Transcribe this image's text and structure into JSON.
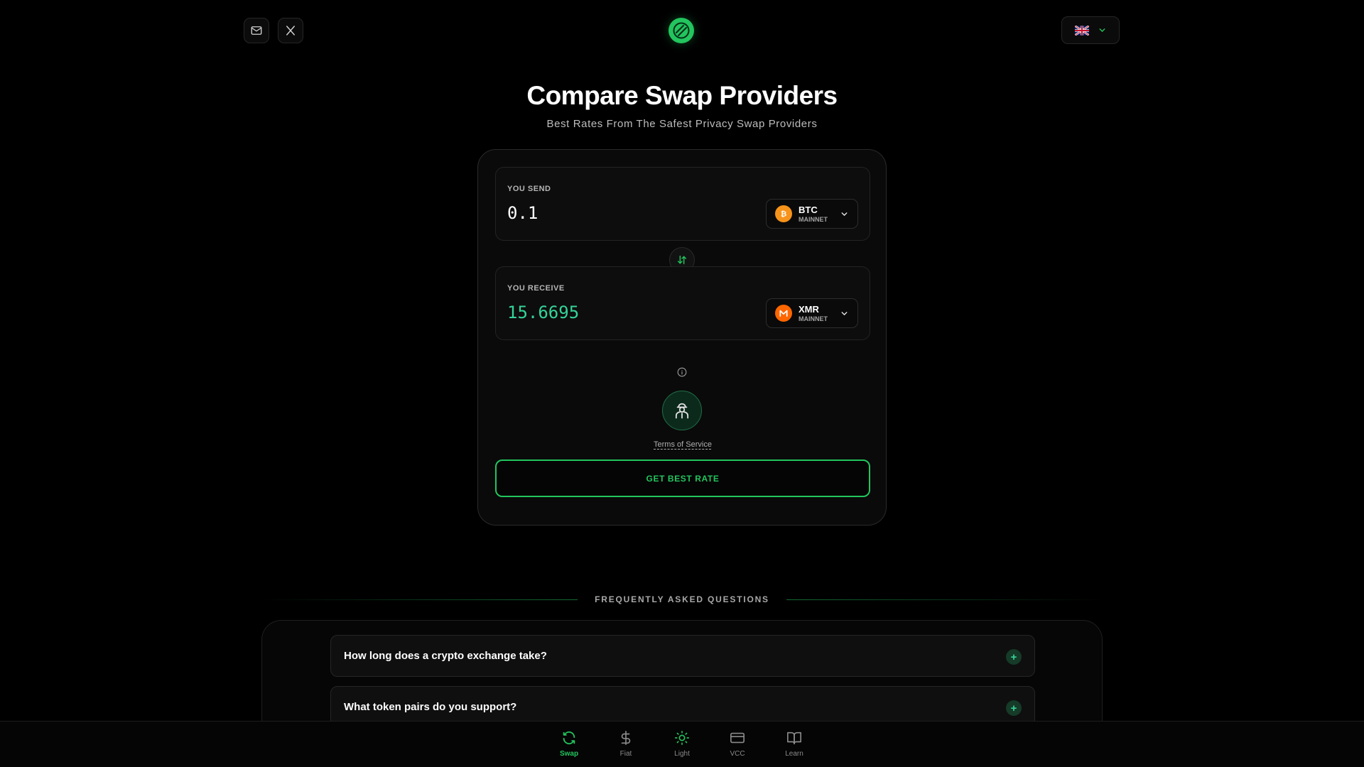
{
  "header": {
    "mail_icon": "mail-icon",
    "x_icon": "x-logo-icon",
    "logo_icon": "brand-logo-icon",
    "language_flag": "uk-flag-icon"
  },
  "hero": {
    "title": "Compare Swap Providers",
    "subtitle": "Best Rates From The Safest Privacy Swap Providers"
  },
  "swap": {
    "send": {
      "label": "YOU SEND",
      "amount": "0.1",
      "symbol": "BTC",
      "network": "MAINNET"
    },
    "receive": {
      "label": "YOU RECEIVE",
      "amount": "15.6695",
      "symbol": "XMR",
      "network": "MAINNET"
    },
    "terms_label": "Terms of Service",
    "cta_label": "GET BEST RATE"
  },
  "faq": {
    "title": "FREQUENTLY ASKED QUESTIONS",
    "items": [
      {
        "question": "How long does a crypto exchange take?"
      },
      {
        "question": "What token pairs do you support?"
      }
    ]
  },
  "nav": {
    "items": [
      {
        "label": "Swap",
        "active": true
      },
      {
        "label": "Fiat"
      },
      {
        "label": "Light"
      },
      {
        "label": "VCC"
      },
      {
        "label": "Learn"
      }
    ]
  },
  "colors": {
    "accent": "#22c55e",
    "receive_amount": "#34d399",
    "background": "#000000",
    "btc": "#f7931a",
    "xmr": "#ff6600"
  }
}
